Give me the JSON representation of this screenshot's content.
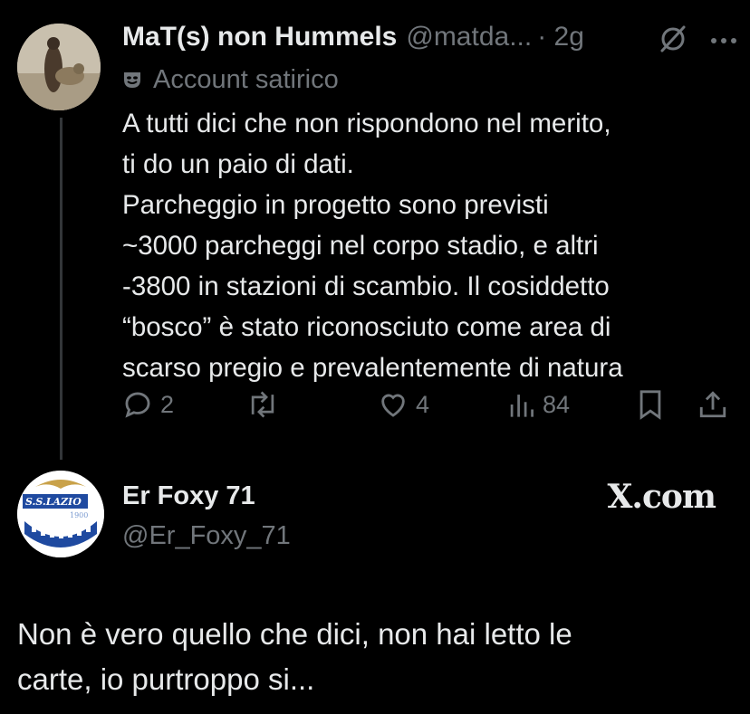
{
  "tweet": {
    "author_name": "MaT(s) non Hummels",
    "handle": "@matda...",
    "time": "· 2g",
    "satire_label": "Account satirico",
    "text": "A tutti dici che non rispondono nel merito,\nti do un paio di dati.\nParcheggio in progetto sono previsti\n~3000 parcheggi nel corpo stadio, e altri\n-3800 in stazioni di scambio. Il cosiddetto\n“bosco” è stato riconosciuto come area di\nscarso pregio e prevalentemente di natura",
    "replies": "2",
    "reposts": "",
    "likes": "4",
    "views": "84"
  },
  "quote_card": {
    "name": "Er Foxy 71",
    "handle": "@Er_Foxy_71",
    "brand": "X.com",
    "avatar_text": "S.S.LAZIO",
    "avatar_year": "1900",
    "text": "Non è vero quello che dici, non hai letto le\ncarte, io purtroppo si..."
  },
  "icons": [
    "grok-slash-icon",
    "more-icon",
    "satire-mask-icon",
    "reply-icon",
    "repost-icon",
    "like-icon",
    "views-icon",
    "bookmark-icon",
    "share-icon"
  ],
  "colors": {
    "background": "#000000",
    "text": "#e7e9ea",
    "muted": "#71767b",
    "lazio_blue": "#1f4aa0"
  }
}
